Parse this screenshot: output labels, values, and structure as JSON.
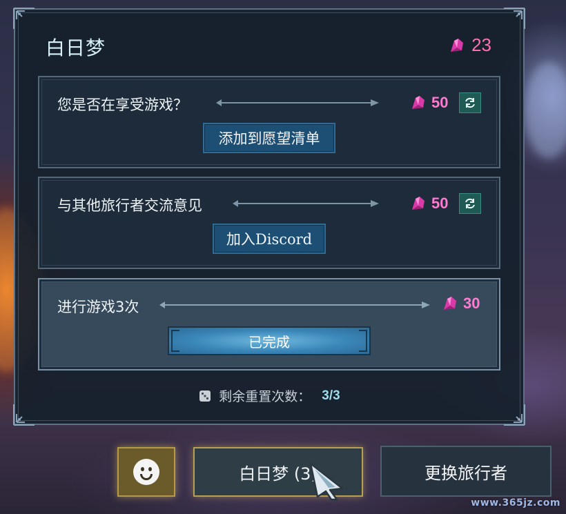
{
  "panel": {
    "title": "白日梦",
    "currency": {
      "icon": "pink-crystal-icon",
      "amount": "23"
    }
  },
  "tasks": [
    {
      "label": "您是否在享受游戏？",
      "reward": "50",
      "reward_icon": "pink-crystal-icon",
      "action": "添加到愿望清单",
      "refresh_icon": "refresh-icon",
      "completed": false
    },
    {
      "label": "与其他旅行者交流意见",
      "reward": "50",
      "reward_icon": "pink-crystal-icon",
      "action": "加入Discord",
      "refresh_icon": "refresh-icon",
      "completed": false
    },
    {
      "label": "进行游戏3次",
      "reward": "30",
      "reward_icon": "pink-crystal-icon",
      "action": "已完成",
      "completed": true
    }
  ],
  "reset": {
    "label": "剩余重置次数：",
    "count": "3/3",
    "icon": "dice-icon"
  },
  "bottom_bar": {
    "emoji_icon": "smiley-face-icon",
    "daydream_label": "白日梦 (3)",
    "swap_label": "更换旅行者"
  },
  "watermark": "www.365jz.com",
  "colors": {
    "panel_bg": "#16202c",
    "accent_pink": "#ff6fb0",
    "button_blue": "#1d4e74",
    "refresh_green": "#1f5a55",
    "gold_border": "#b9a04e"
  }
}
